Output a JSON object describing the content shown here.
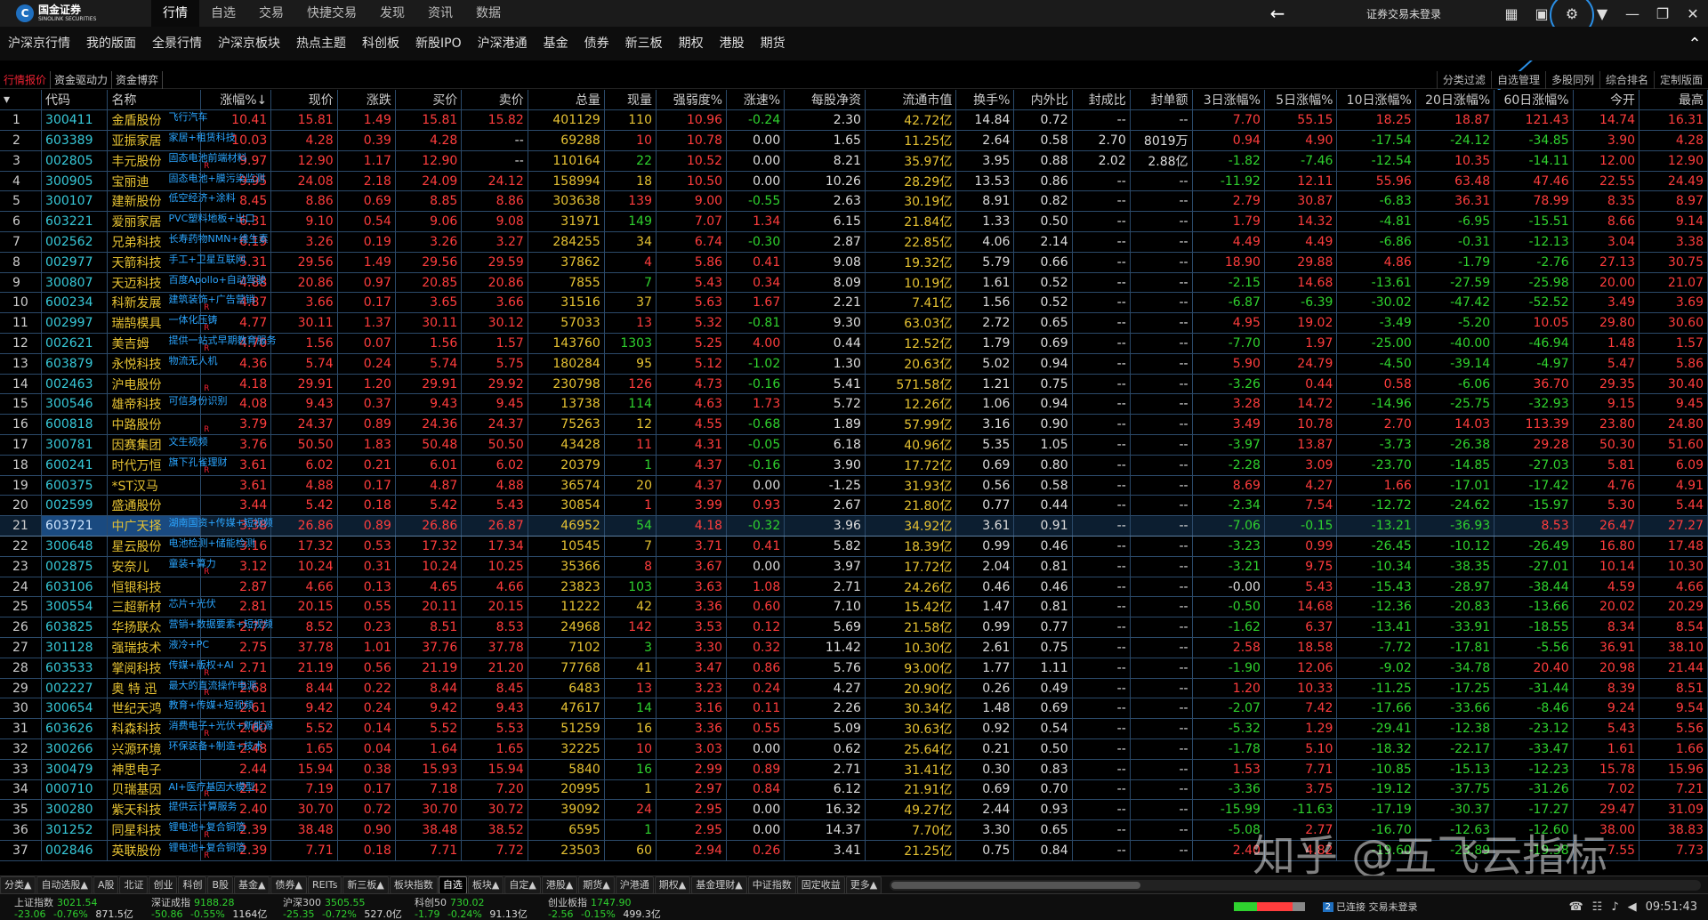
{
  "app": {
    "logo_text": "国金证券",
    "logo_sub": "SINOLINK SECURITIES",
    "menu": [
      "行情",
      "自选",
      "交易",
      "快捷交易",
      "发现",
      "资讯",
      "数据"
    ],
    "menu_active": 0,
    "login_status": "证券交易未登录",
    "accent": "#2a8fe6"
  },
  "toolbar2": [
    "沪深京行情",
    "我的版面",
    "全景行情",
    "沪深京板块",
    "热点主题",
    "科创板",
    "新股IPO",
    "沪深港通",
    "基金",
    "债券",
    "新三板",
    "期权",
    "港股",
    "期货"
  ],
  "subtabs": [
    "行情报价",
    "资金驱动力",
    "资金博弈"
  ],
  "right_buttons": [
    "分类过滤",
    "自选管理",
    "多股同列",
    "综合排名",
    "定制版面"
  ],
  "columns": [
    "",
    "代码",
    "名称",
    "涨幅%↓",
    "现价",
    "涨跌",
    "买价",
    "卖价",
    "总量",
    "现量",
    "强弱度%",
    "涨速%",
    "每股净资",
    "流通市值",
    "换手%",
    "内外比",
    "封成比",
    "封单额",
    "3日涨幅%",
    "5日涨幅%",
    "10日涨幅%",
    "20日涨幅%",
    "60日涨幅%",
    "今开",
    "最高"
  ],
  "rows": [
    [
      "1",
      "300411",
      "金盾股份",
      "10.41",
      "15.81",
      "1.49",
      "15.81",
      "15.82",
      "401129",
      "110",
      "10.96",
      "-0.24",
      "2.30",
      "42.72亿",
      "14.84",
      "0.72",
      "--",
      "--",
      "7.70",
      "55.15",
      "18.25",
      "18.87",
      "121.43",
      "14.74",
      "16.31"
    ],
    [
      "2",
      "603389",
      "亚振家居",
      "10.03",
      "4.28",
      "0.39",
      "4.28",
      "--",
      "69288",
      "10",
      "10.78",
      "0.00",
      "1.65",
      "11.25亿",
      "2.64",
      "0.58",
      "2.70",
      "8019万",
      "0.94",
      "4.90",
      "-17.54",
      "-24.12",
      "-34.85",
      "3.90",
      "4.28"
    ],
    [
      "3",
      "002805",
      "丰元股份",
      "9.97",
      "12.90",
      "1.17",
      "12.90",
      "--",
      "110164",
      "22",
      "10.52",
      "0.00",
      "8.21",
      "35.97亿",
      "3.95",
      "0.88",
      "2.02",
      "2.88亿",
      "-1.82",
      "-7.46",
      "-12.54",
      "10.35",
      "-14.11",
      "12.00",
      "12.90"
    ],
    [
      "4",
      "300905",
      "宝丽迪",
      "9.95",
      "24.08",
      "2.18",
      "24.09",
      "24.12",
      "158994",
      "18",
      "10.50",
      "0.00",
      "10.26",
      "28.29亿",
      "13.53",
      "0.86",
      "--",
      "--",
      "-11.92",
      "12.11",
      "55.96",
      "63.48",
      "47.46",
      "22.55",
      "24.49"
    ],
    [
      "5",
      "300107",
      "建新股份",
      "8.45",
      "8.86",
      "0.69",
      "8.85",
      "8.86",
      "303638",
      "139",
      "9.00",
      "-0.55",
      "2.63",
      "30.19亿",
      "8.91",
      "0.82",
      "--",
      "--",
      "2.79",
      "30.87",
      "-6.83",
      "36.31",
      "78.99",
      "8.35",
      "8.97"
    ],
    [
      "6",
      "603221",
      "爱丽家居",
      "6.31",
      "9.10",
      "0.54",
      "9.06",
      "9.08",
      "31971",
      "149",
      "7.07",
      "1.34",
      "6.15",
      "21.84亿",
      "1.33",
      "0.50",
      "--",
      "--",
      "1.79",
      "14.32",
      "-4.81",
      "-6.95",
      "-15.51",
      "8.66",
      "9.14"
    ],
    [
      "7",
      "002562",
      "兄弟科技",
      "6.19",
      "3.26",
      "0.19",
      "3.26",
      "3.27",
      "284255",
      "34",
      "6.74",
      "-0.30",
      "2.87",
      "22.85亿",
      "4.06",
      "2.14",
      "--",
      "--",
      "4.49",
      "4.49",
      "-6.86",
      "-0.31",
      "-12.13",
      "3.04",
      "3.38"
    ],
    [
      "8",
      "002977",
      "天箭科技",
      "5.31",
      "29.56",
      "1.49",
      "29.56",
      "29.59",
      "37862",
      "4",
      "5.86",
      "0.41",
      "9.08",
      "19.32亿",
      "5.79",
      "0.66",
      "--",
      "--",
      "18.90",
      "29.88",
      "4.86",
      "-1.79",
      "-2.76",
      "27.13",
      "30.75"
    ],
    [
      "9",
      "300807",
      "天迈科技",
      "4.88",
      "20.86",
      "0.97",
      "20.85",
      "20.86",
      "7855",
      "7",
      "5.43",
      "0.34",
      "8.09",
      "10.19亿",
      "1.61",
      "0.52",
      "--",
      "--",
      "-2.15",
      "14.68",
      "-13.61",
      "-27.59",
      "-25.98",
      "20.00",
      "21.07"
    ],
    [
      "10",
      "600234",
      "科新发展",
      "4.87",
      "3.66",
      "0.17",
      "3.65",
      "3.66",
      "31516",
      "37",
      "5.63",
      "1.67",
      "2.21",
      "7.41亿",
      "1.56",
      "0.52",
      "--",
      "--",
      "-6.87",
      "-6.39",
      "-30.02",
      "-47.42",
      "-52.52",
      "3.49",
      "3.69"
    ],
    [
      "11",
      "002997",
      "瑞鹄模具",
      "4.77",
      "30.11",
      "1.37",
      "30.11",
      "30.12",
      "57033",
      "13",
      "5.32",
      "-0.81",
      "9.30",
      "63.03亿",
      "2.72",
      "0.65",
      "--",
      "--",
      "4.95",
      "19.02",
      "-3.49",
      "-5.20",
      "10.05",
      "29.80",
      "30.60"
    ],
    [
      "12",
      "002621",
      "美吉姆",
      "4.70",
      "1.56",
      "0.07",
      "1.56",
      "1.57",
      "143760",
      "1303",
      "5.25",
      "4.00",
      "0.44",
      "12.52亿",
      "1.79",
      "0.69",
      "--",
      "--",
      "-7.70",
      "1.97",
      "-25.00",
      "-40.00",
      "-46.94",
      "1.48",
      "1.57"
    ],
    [
      "13",
      "603879",
      "永悦科技",
      "4.36",
      "5.74",
      "0.24",
      "5.74",
      "5.75",
      "180284",
      "95",
      "5.12",
      "-1.02",
      "1.30",
      "20.63亿",
      "5.02",
      "0.94",
      "--",
      "--",
      "5.90",
      "24.79",
      "-4.50",
      "-39.14",
      "-4.97",
      "5.47",
      "5.86"
    ],
    [
      "14",
      "002463",
      "沪电股份",
      "4.18",
      "29.91",
      "1.20",
      "29.91",
      "29.92",
      "230798",
      "126",
      "4.73",
      "-0.16",
      "5.41",
      "571.58亿",
      "1.21",
      "0.75",
      "--",
      "--",
      "-3.26",
      "0.44",
      "0.58",
      "-6.06",
      "36.70",
      "29.35",
      "30.40"
    ],
    [
      "15",
      "300546",
      "雄帝科技",
      "4.08",
      "9.43",
      "0.37",
      "9.43",
      "9.45",
      "13738",
      "114",
      "4.63",
      "1.73",
      "5.72",
      "12.26亿",
      "1.06",
      "0.94",
      "--",
      "--",
      "3.28",
      "14.72",
      "-14.96",
      "-25.75",
      "-32.93",
      "9.15",
      "9.45"
    ],
    [
      "16",
      "600818",
      "中路股份",
      "3.79",
      "24.37",
      "0.89",
      "24.36",
      "24.37",
      "75263",
      "12",
      "4.55",
      "-0.68",
      "1.89",
      "57.99亿",
      "3.16",
      "0.90",
      "--",
      "--",
      "3.49",
      "10.78",
      "2.70",
      "14.03",
      "113.39",
      "23.80",
      "24.80"
    ],
    [
      "17",
      "300781",
      "因赛集团",
      "3.76",
      "50.50",
      "1.83",
      "50.48",
      "50.50",
      "43428",
      "11",
      "4.31",
      "-0.05",
      "6.18",
      "40.96亿",
      "5.35",
      "1.05",
      "--",
      "--",
      "-3.97",
      "13.87",
      "-3.73",
      "-26.38",
      "29.28",
      "50.30",
      "51.60"
    ],
    [
      "18",
      "600241",
      "时代万恒",
      "3.61",
      "6.02",
      "0.21",
      "6.01",
      "6.02",
      "20379",
      "1",
      "4.37",
      "-0.16",
      "3.90",
      "17.72亿",
      "0.69",
      "0.80",
      "--",
      "--",
      "-2.28",
      "3.09",
      "-23.70",
      "-14.85",
      "-27.03",
      "5.81",
      "6.09"
    ],
    [
      "19",
      "600375",
      "*ST汉马",
      "3.61",
      "4.88",
      "0.17",
      "4.87",
      "4.88",
      "36574",
      "20",
      "4.37",
      "0.00",
      "-1.25",
      "31.93亿",
      "0.56",
      "0.58",
      "--",
      "--",
      "8.69",
      "4.27",
      "1.66",
      "-17.01",
      "-17.42",
      "4.76",
      "4.91"
    ],
    [
      "20",
      "002599",
      "盛通股份",
      "3.44",
      "5.42",
      "0.18",
      "5.42",
      "5.43",
      "30854",
      "1",
      "3.99",
      "0.93",
      "2.67",
      "21.80亿",
      "0.77",
      "0.44",
      "--",
      "--",
      "-2.34",
      "7.54",
      "-12.72",
      "-24.62",
      "-15.97",
      "5.30",
      "5.44"
    ],
    [
      "21",
      "603721",
      "中广天择",
      "3.38",
      "26.86",
      "0.89",
      "26.86",
      "26.87",
      "46952",
      "54",
      "4.18",
      "-0.32",
      "3.96",
      "34.92亿",
      "3.61",
      "0.91",
      "--",
      "--",
      "-7.06",
      "-0.15",
      "-13.21",
      "-36.93",
      "8.53",
      "26.47",
      "27.27"
    ],
    [
      "22",
      "300648",
      "星云股份",
      "3.16",
      "17.32",
      "0.53",
      "17.32",
      "17.34",
      "10545",
      "7",
      "3.71",
      "0.41",
      "5.82",
      "18.39亿",
      "0.99",
      "0.46",
      "--",
      "--",
      "-3.23",
      "0.99",
      "-26.45",
      "-10.12",
      "-26.49",
      "16.80",
      "17.48"
    ],
    [
      "23",
      "002875",
      "安奈儿",
      "3.12",
      "10.24",
      "0.31",
      "10.24",
      "10.25",
      "35366",
      "8",
      "3.67",
      "0.00",
      "3.97",
      "17.72亿",
      "2.04",
      "0.81",
      "--",
      "--",
      "-3.21",
      "9.75",
      "-10.34",
      "-38.35",
      "-27.01",
      "10.14",
      "10.30"
    ],
    [
      "24",
      "603106",
      "恒银科技",
      "2.87",
      "4.66",
      "0.13",
      "4.65",
      "4.66",
      "23823",
      "103",
      "3.63",
      "1.08",
      "2.71",
      "24.26亿",
      "0.46",
      "0.46",
      "--",
      "--",
      "-0.00",
      "5.43",
      "-15.43",
      "-28.97",
      "-38.44",
      "4.59",
      "4.66"
    ],
    [
      "25",
      "300554",
      "三超新材",
      "2.81",
      "20.15",
      "0.55",
      "20.11",
      "20.15",
      "11222",
      "42",
      "3.36",
      "0.60",
      "7.10",
      "15.42亿",
      "1.47",
      "0.81",
      "--",
      "--",
      "-0.50",
      "14.68",
      "-12.36",
      "-20.83",
      "-13.66",
      "20.02",
      "20.29"
    ],
    [
      "26",
      "603825",
      "华扬联众",
      "2.77",
      "8.52",
      "0.23",
      "8.51",
      "8.53",
      "24968",
      "142",
      "3.53",
      "0.12",
      "5.69",
      "21.58亿",
      "0.99",
      "0.77",
      "--",
      "--",
      "-1.62",
      "6.37",
      "-13.41",
      "-33.91",
      "-18.55",
      "8.34",
      "8.54"
    ],
    [
      "27",
      "301128",
      "强瑞技术",
      "2.75",
      "37.78",
      "1.01",
      "37.76",
      "37.78",
      "7102",
      "3",
      "3.30",
      "0.32",
      "11.42",
      "10.30亿",
      "2.61",
      "0.75",
      "--",
      "--",
      "2.58",
      "18.58",
      "-7.72",
      "-17.81",
      "-5.56",
      "36.91",
      "38.10"
    ],
    [
      "28",
      "603533",
      "掌阅科技",
      "2.71",
      "21.19",
      "0.56",
      "21.19",
      "21.20",
      "77768",
      "41",
      "3.47",
      "0.86",
      "5.76",
      "93.00亿",
      "1.77",
      "1.11",
      "--",
      "--",
      "-1.90",
      "12.06",
      "-9.02",
      "-34.78",
      "20.40",
      "20.98",
      "21.44"
    ],
    [
      "29",
      "002227",
      "奥 特 迅",
      "2.68",
      "8.44",
      "0.22",
      "8.44",
      "8.45",
      "6483",
      "13",
      "3.23",
      "0.24",
      "4.27",
      "20.90亿",
      "0.26",
      "0.49",
      "--",
      "--",
      "1.20",
      "10.33",
      "-11.25",
      "-17.25",
      "-31.44",
      "8.39",
      "8.51"
    ],
    [
      "30",
      "300654",
      "世纪天鸿",
      "2.61",
      "9.42",
      "0.24",
      "9.42",
      "9.43",
      "47617",
      "14",
      "3.16",
      "0.11",
      "2.26",
      "30.34亿",
      "1.48",
      "0.69",
      "--",
      "--",
      "-2.07",
      "7.42",
      "-17.66",
      "-33.66",
      "-8.46",
      "9.24",
      "9.54"
    ],
    [
      "31",
      "603626",
      "科森科技",
      "2.60",
      "5.52",
      "0.14",
      "5.52",
      "5.53",
      "51259",
      "16",
      "3.36",
      "0.55",
      "5.09",
      "30.63亿",
      "0.92",
      "0.54",
      "--",
      "--",
      "-5.32",
      "1.29",
      "-29.41",
      "-12.38",
      "-23.12",
      "5.43",
      "5.56"
    ],
    [
      "32",
      "300266",
      "兴源环境",
      "2.48",
      "1.65",
      "0.04",
      "1.64",
      "1.65",
      "32225",
      "10",
      "3.03",
      "0.00",
      "0.62",
      "25.64亿",
      "0.21",
      "0.50",
      "--",
      "--",
      "-1.78",
      "5.10",
      "-18.32",
      "-22.17",
      "-33.47",
      "1.61",
      "1.66"
    ],
    [
      "33",
      "300479",
      "神思电子",
      "2.44",
      "15.94",
      "0.38",
      "15.93",
      "15.94",
      "5840",
      "16",
      "2.99",
      "0.89",
      "2.71",
      "31.41亿",
      "0.30",
      "0.83",
      "--",
      "--",
      "1.53",
      "7.71",
      "-10.85",
      "-15.13",
      "-12.23",
      "15.78",
      "15.96"
    ],
    [
      "34",
      "000710",
      "贝瑞基因",
      "2.42",
      "7.19",
      "0.17",
      "7.18",
      "7.20",
      "20995",
      "1",
      "2.97",
      "0.84",
      "6.12",
      "21.91亿",
      "0.69",
      "0.70",
      "--",
      "--",
      "-3.36",
      "3.75",
      "-19.12",
      "-37.75",
      "-31.26",
      "7.02",
      "7.21"
    ],
    [
      "35",
      "300280",
      "紫天科技",
      "2.40",
      "30.70",
      "0.72",
      "30.70",
      "30.72",
      "39092",
      "24",
      "2.95",
      "0.00",
      "16.32",
      "49.27亿",
      "2.44",
      "0.93",
      "--",
      "--",
      "-15.99",
      "-11.63",
      "-17.19",
      "-30.37",
      "-17.27",
      "29.47",
      "31.09"
    ],
    [
      "36",
      "301252",
      "同星科技",
      "2.39",
      "38.48",
      "0.90",
      "38.48",
      "38.52",
      "6595",
      "1",
      "2.95",
      "0.00",
      "14.37",
      "7.70亿",
      "3.30",
      "0.65",
      "--",
      "--",
      "-5.08",
      "2.77",
      "-16.70",
      "-12.63",
      "-12.60",
      "38.00",
      "38.83"
    ],
    [
      "37",
      "002846",
      "英联股份",
      "2.39",
      "7.71",
      "0.18",
      "7.71",
      "7.72",
      "23503",
      "60",
      "2.94",
      "0.26",
      "3.41",
      "21.25亿",
      "0.75",
      "0.84",
      "--",
      "--",
      "2.40",
      "4.82",
      "-19.60",
      "-23.89",
      "-19.38",
      "7.55",
      "7.73"
    ]
  ],
  "tags": {
    "1": "飞行汽车",
    "2": "家居+租赁科技",
    "3": "固态电池前端材料",
    "4": "固态电池+膜污染监测",
    "5": "低空经济+涂料",
    "6": "PVC塑料地板+出口",
    "7": "长寿药物NMN+维生素",
    "8": "手工+卫星互联网",
    "9": "百度Apollo+自动驾驶",
    "10": "建筑装饰+广告营销",
    "11": "一体化压铸",
    "12": "提供一站式早期教育服务",
    "13": "物流无人机",
    "15": "可信身份识别",
    "17": "文生视频",
    "18": "旗下孔雀理财",
    "21": "湖南国资+传媒+短视频",
    "22": "电池检测+储能检测",
    "23": "童装+算力",
    "25": "芯片+光伏",
    "26": "营销+数据要素+短视频",
    "27": "液冷+PC",
    "28": "传媒+版权+AI",
    "29": "最大的直流操作电源",
    "30": "教育+传媒+短视频",
    "31": "消费电子+光伏+新能源",
    "32": "环保装备+制造+技术",
    "34": "AI+医疗基因大模型",
    "35": "提供云计算服务",
    "36": "锂电池+复合铜箔",
    "37": "锂电池+复合铜箔"
  },
  "r_marks": [
    3,
    4,
    5,
    6,
    7,
    8,
    9,
    10,
    11,
    12,
    13,
    14,
    15,
    16,
    17,
    18,
    19,
    20,
    21,
    22,
    23,
    24,
    25,
    26,
    27,
    28,
    29,
    30,
    31,
    32,
    33,
    34,
    35,
    36,
    37
  ],
  "selected_row": 21,
  "bottom_tabs": [
    "分类▲",
    "自动选股▲",
    "A股",
    "北证",
    "创业",
    "科创",
    "B股",
    "基金▲",
    "债券▲",
    "REITs",
    "新三板▲",
    "板块指数",
    "自选",
    "板块▲",
    "自定▲",
    "港股▲",
    "期货▲",
    "沪港通",
    "期权▲",
    "基金理财▲",
    "中证指数",
    "固定收益",
    "更多▲"
  ],
  "bottom_active": 12,
  "status": {
    "indices": [
      {
        "name": "上证指数",
        "value": "3021.54",
        "chg": "-23.06",
        "pct": "-0.76%",
        "vol": "871.5亿"
      },
      {
        "name": "深证成指",
        "value": "9188.28",
        "chg": "-50.86",
        "pct": "-0.55%",
        "vol": "1164亿"
      },
      {
        "name": "沪深300",
        "value": "3505.55",
        "chg": "-25.35",
        "pct": "-0.72%",
        "vol": "527.0亿"
      },
      {
        "name": "科创50",
        "value": "730.02",
        "chg": "-1.79",
        "pct": "-0.24%",
        "vol": "91.13亿"
      },
      {
        "name": "创业板指",
        "value": "1747.90",
        "chg": "-2.56",
        "pct": "-0.15%",
        "vol": "499.3亿"
      }
    ],
    "conn_badge": "2",
    "conn_text": "已连接 交易未登录",
    "time": "09:51:43"
  },
  "watermark": "知乎 @五飞云指标",
  "colors": {
    "up": "#ff3d3d",
    "down": "#2fd22f",
    "code": "#37c8d8",
    "name": "#e6c233",
    "grid": "#2b4a6a"
  }
}
